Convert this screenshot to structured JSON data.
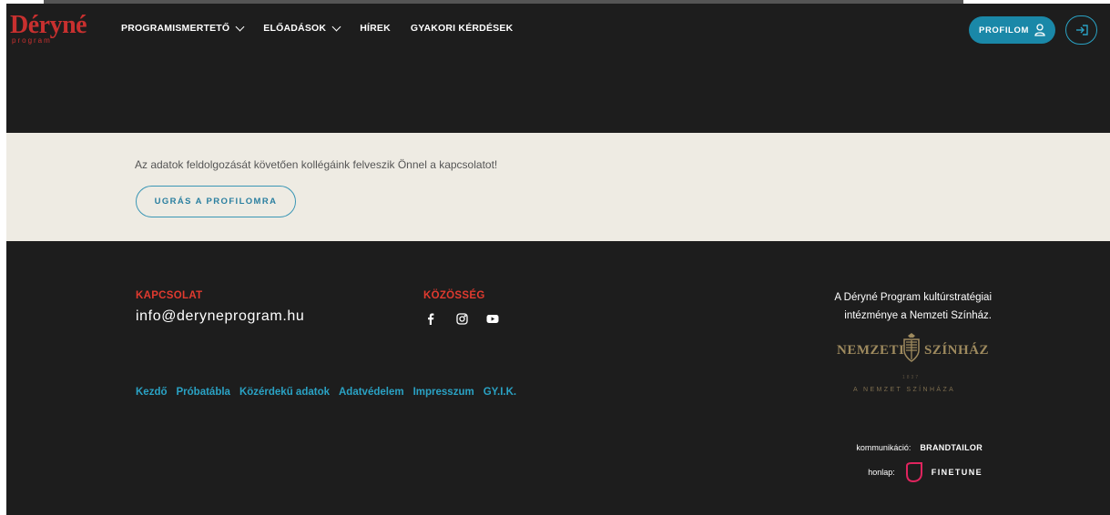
{
  "header": {
    "logo_text": "Déryné",
    "logo_sub": "program",
    "nav": [
      {
        "label": "PROGRAMISMERTETŐ",
        "dropdown": true
      },
      {
        "label": "ELŐADÁSOK",
        "dropdown": true
      },
      {
        "label": "HÍREK",
        "dropdown": false
      },
      {
        "label": "GYAKORI KÉRDÉSEK",
        "dropdown": false
      }
    ],
    "profile_label": "PROFILOM",
    "icons": {
      "profile": "user-icon",
      "login": "login-arrow-icon"
    }
  },
  "notice": {
    "text": "Az adatok feldolgozását követően kollégáink felveszik Önnel a kapcsolatot!",
    "button_label": "UGRÁS A PROFILOMRA"
  },
  "footer": {
    "contact_heading": "KAPCSOLAT",
    "email": "info@deryneprogram.hu",
    "community_heading": "KÖZÖSSÉG",
    "social": [
      "facebook-icon",
      "instagram-icon",
      "youtube-icon"
    ],
    "links": [
      "Kezdő",
      "Próbatábla",
      "Közérdekű adatok",
      "Adatvédelem",
      "Impresszum",
      "GY.I.K."
    ],
    "strategy_line1": "A Déryné Program kultúrstratégiai",
    "strategy_line2": "intézménye a Nemzeti Színház.",
    "nemzeti_logo": {
      "left": "NEMZETI",
      "right": "SZÍNHÁZ",
      "year": "1837",
      "sub": "A NEMZET SZÍNHÁZA"
    },
    "credit_comm_label": "kommunikáció:",
    "credit_comm_brand": "BRANDTAILOR",
    "credit_web_label": "honlap:",
    "credit_web_brand": "FINETUNE"
  },
  "colors": {
    "background": "#1d1d1d",
    "accent_blue": "#1a88a8",
    "link_blue": "#2aa2c4",
    "heading_red": "#e03a2f",
    "logo_red": "#c8302f",
    "cream": "#eeebe3",
    "gold": "#9e8a5e",
    "finetune_pink": "#e0245e"
  }
}
